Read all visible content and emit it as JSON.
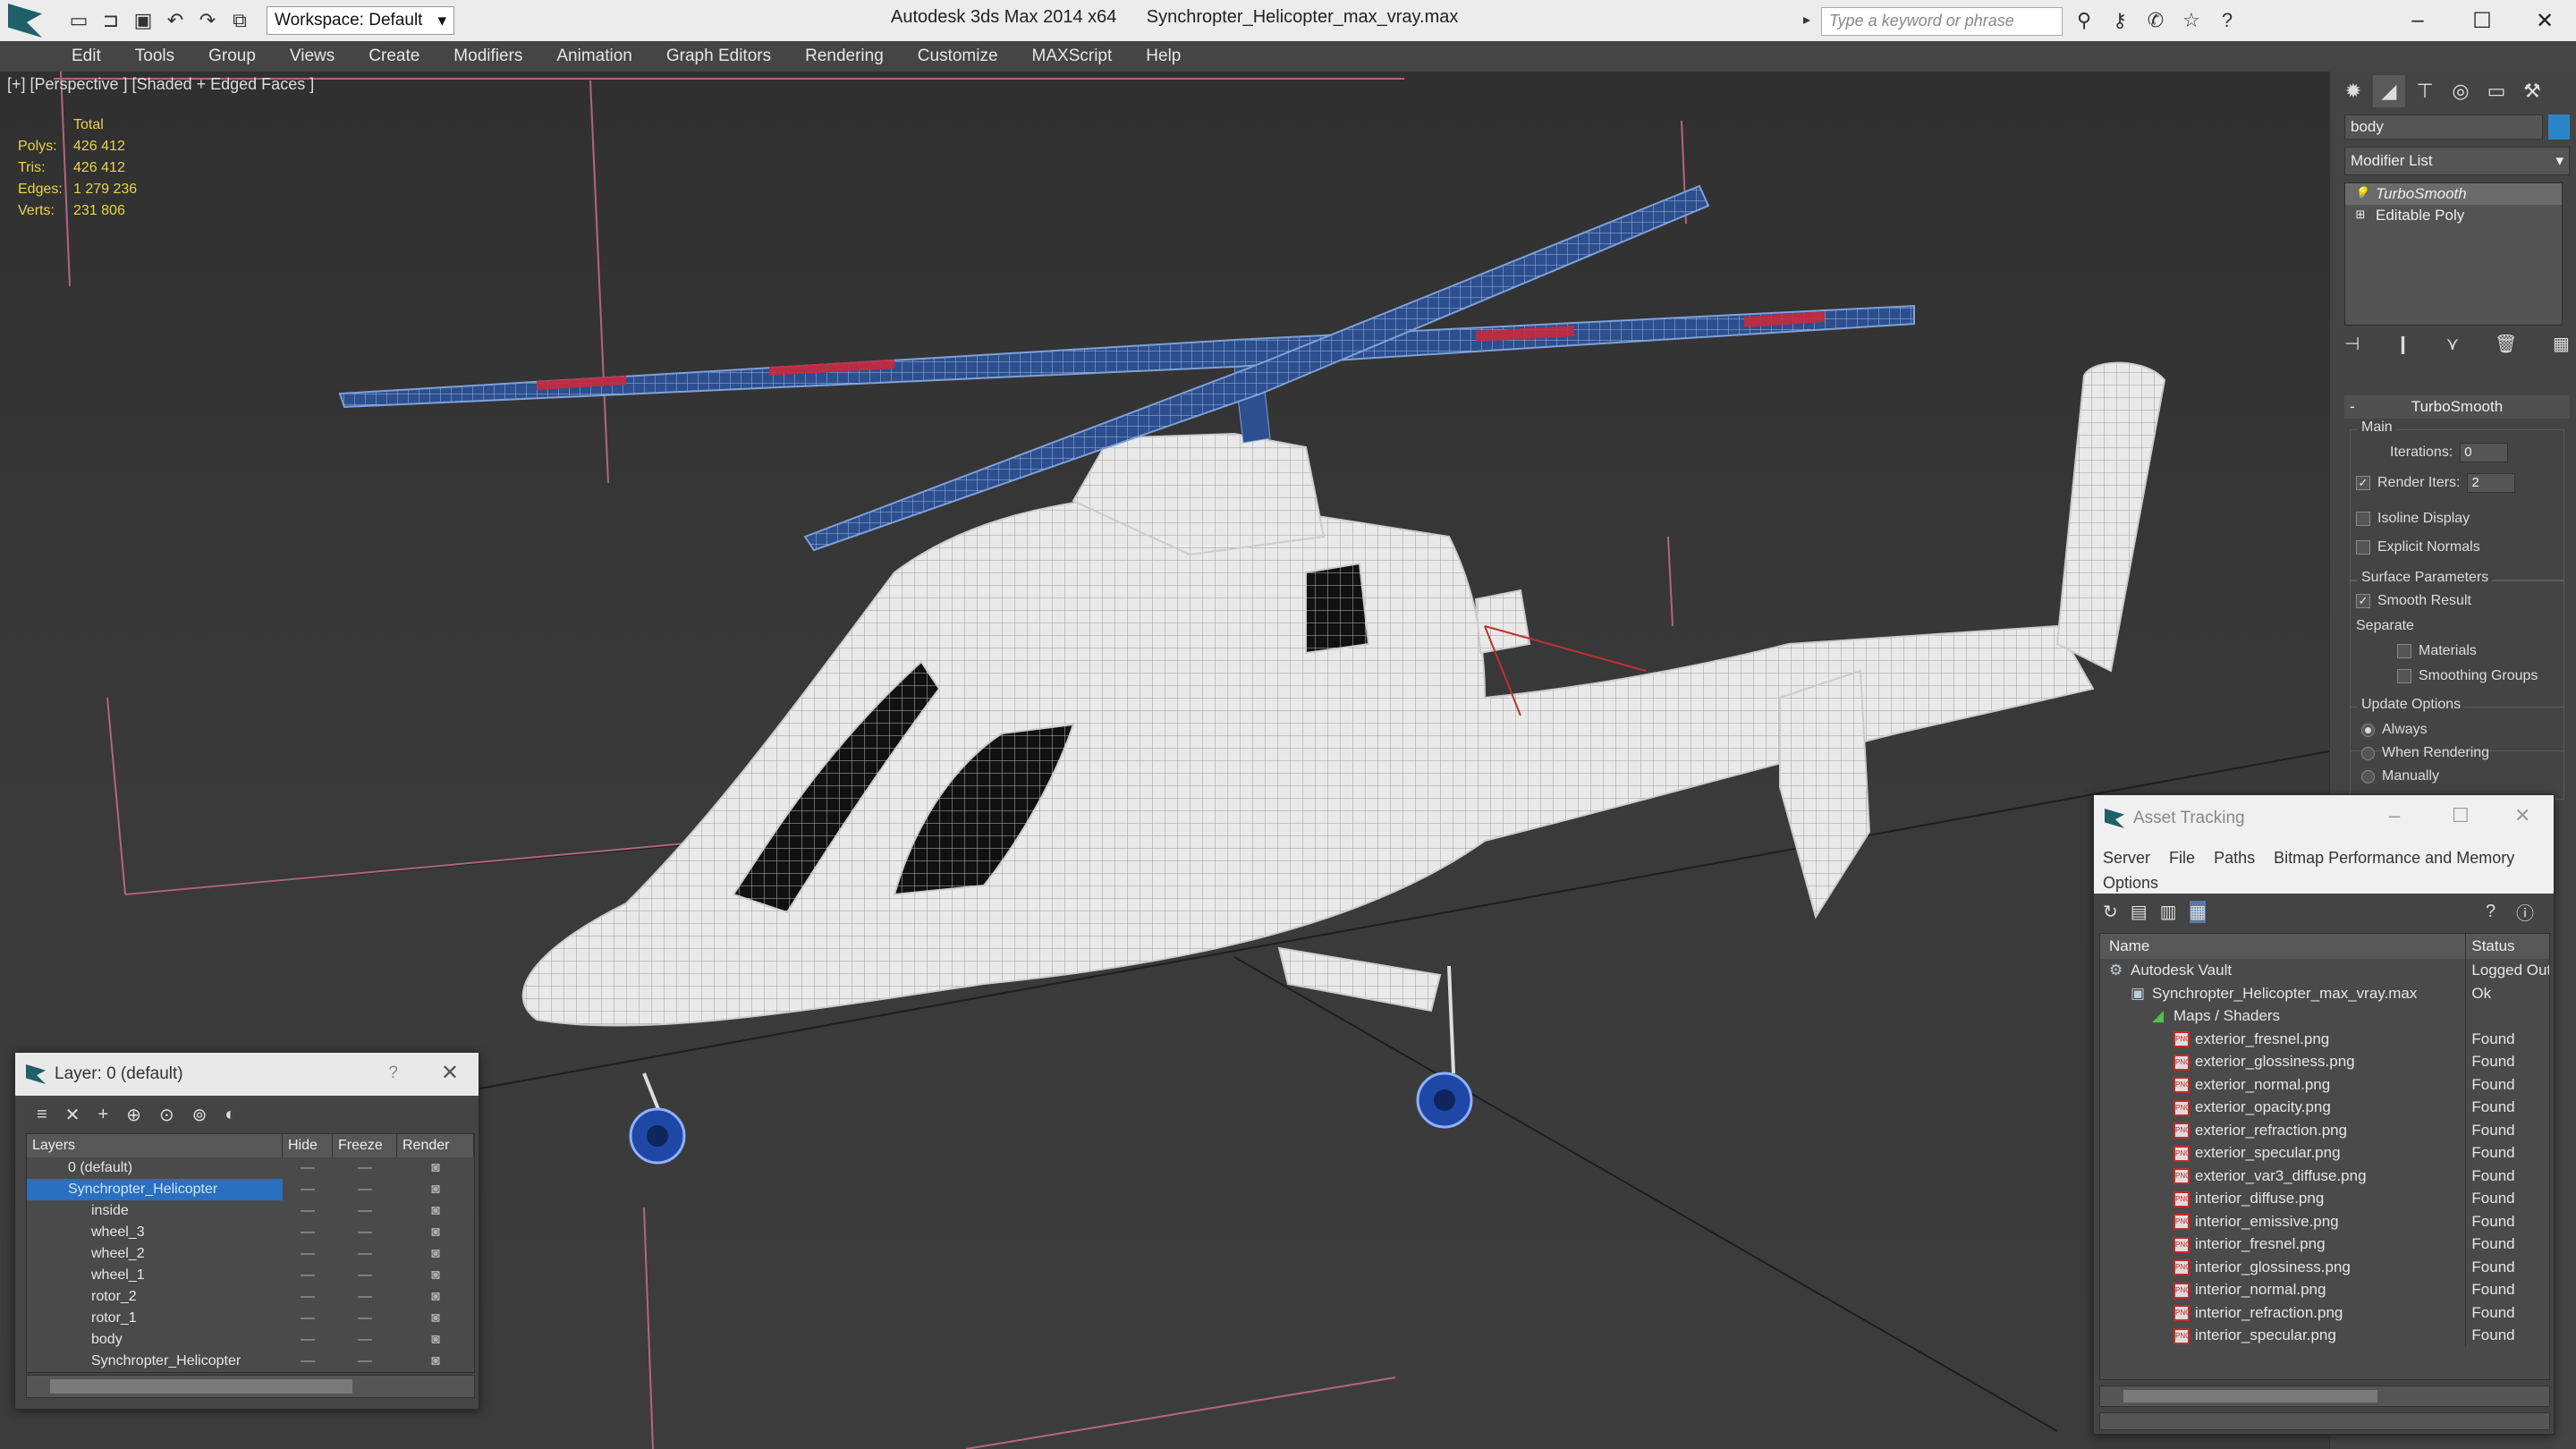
{
  "titlebar": {
    "workspace_label": "Workspace: Default",
    "app_name": "Autodesk 3ds Max 2014 x64",
    "file_name": "Synchropter_Helicopter_max_vray.max",
    "search_placeholder": "Type a keyword or phrase"
  },
  "menu": [
    "Edit",
    "Tools",
    "Group",
    "Views",
    "Create",
    "Modifiers",
    "Animation",
    "Graph Editors",
    "Rendering",
    "Customize",
    "MAXScript",
    "Help"
  ],
  "viewport": {
    "label": "[+] [Perspective ] [Shaded + Edged Faces ]",
    "stats": {
      "total_label": "Total",
      "rows": [
        {
          "key": "Polys:",
          "value": "426 412"
        },
        {
          "key": "Tris:",
          "value": "426 412"
        },
        {
          "key": "Edges:",
          "value": "1 279 236"
        },
        {
          "key": "Verts:",
          "value": "231 806"
        }
      ]
    }
  },
  "command_panel": {
    "object_name": "body",
    "object_color": "#2a85c8",
    "modifier_list_label": "Modifier List",
    "stack": [
      "TurboSmooth",
      "Editable Poly"
    ],
    "rollout_title": "TurboSmooth",
    "main_group": "Main",
    "iterations_label": "Iterations:",
    "iterations_value": "0",
    "render_iters_label": "Render Iters:",
    "render_iters_value": "2",
    "isoline_label": "Isoline Display",
    "explicit_normals_label": "Explicit Normals",
    "surface_group": "Surface Parameters",
    "smooth_result_label": "Smooth Result",
    "separate_label": "Separate",
    "materials_label": "Materials",
    "smoothing_groups_label": "Smoothing Groups",
    "update_group": "Update Options",
    "always_label": "Always",
    "when_rendering_label": "When Rendering",
    "manually_label": "Manually"
  },
  "layer_window": {
    "title": "Layer: 0 (default)",
    "help": "?",
    "columns": [
      "Layers",
      "Hide",
      "Freeze",
      "Render"
    ],
    "rows": [
      {
        "name": "0 (default)",
        "child": false
      },
      {
        "name": "Synchropter_Helicopter",
        "child": false
      },
      {
        "name": "inside",
        "child": true
      },
      {
        "name": "wheel_3",
        "child": true
      },
      {
        "name": "wheel_2",
        "child": true
      },
      {
        "name": "wheel_1",
        "child": true
      },
      {
        "name": "rotor_2",
        "child": true
      },
      {
        "name": "rotor_1",
        "child": true
      },
      {
        "name": "body",
        "child": true
      },
      {
        "name": "Synchropter_Helicopter",
        "child": true
      }
    ]
  },
  "asset_tracking": {
    "title": "Asset Tracking",
    "menu": [
      "Server",
      "File",
      "Paths",
      "Bitmap Performance and Memory",
      "Options"
    ],
    "columns": [
      "Name",
      "Status"
    ],
    "rows": [
      {
        "name": "Autodesk Vault",
        "status": "Logged Out",
        "level": 0
      },
      {
        "name": "Synchropter_Helicopter_max_vray.max",
        "status": "Ok",
        "level": 1
      },
      {
        "name": "Maps / Shaders",
        "status": "",
        "level": 2
      },
      {
        "name": "exterior_fresnel.png",
        "status": "Found",
        "level": 3
      },
      {
        "name": "exterior_glossiness.png",
        "status": "Found",
        "level": 3
      },
      {
        "name": "exterior_normal.png",
        "status": "Found",
        "level": 3
      },
      {
        "name": "exterior_opacity.png",
        "status": "Found",
        "level": 3
      },
      {
        "name": "exterior_refraction.png",
        "status": "Found",
        "level": 3
      },
      {
        "name": "exterior_specular.png",
        "status": "Found",
        "level": 3
      },
      {
        "name": "exterior_var3_diffuse.png",
        "status": "Found",
        "level": 3
      },
      {
        "name": "interior_diffuse.png",
        "status": "Found",
        "level": 3
      },
      {
        "name": "interior_emissive.png",
        "status": "Found",
        "level": 3
      },
      {
        "name": "interior_fresnel.png",
        "status": "Found",
        "level": 3
      },
      {
        "name": "interior_glossiness.png",
        "status": "Found",
        "level": 3
      },
      {
        "name": "interior_normal.png",
        "status": "Found",
        "level": 3
      },
      {
        "name": "interior_refraction.png",
        "status": "Found",
        "level": 3
      },
      {
        "name": "interior_specular.png",
        "status": "Found",
        "level": 3
      }
    ]
  }
}
